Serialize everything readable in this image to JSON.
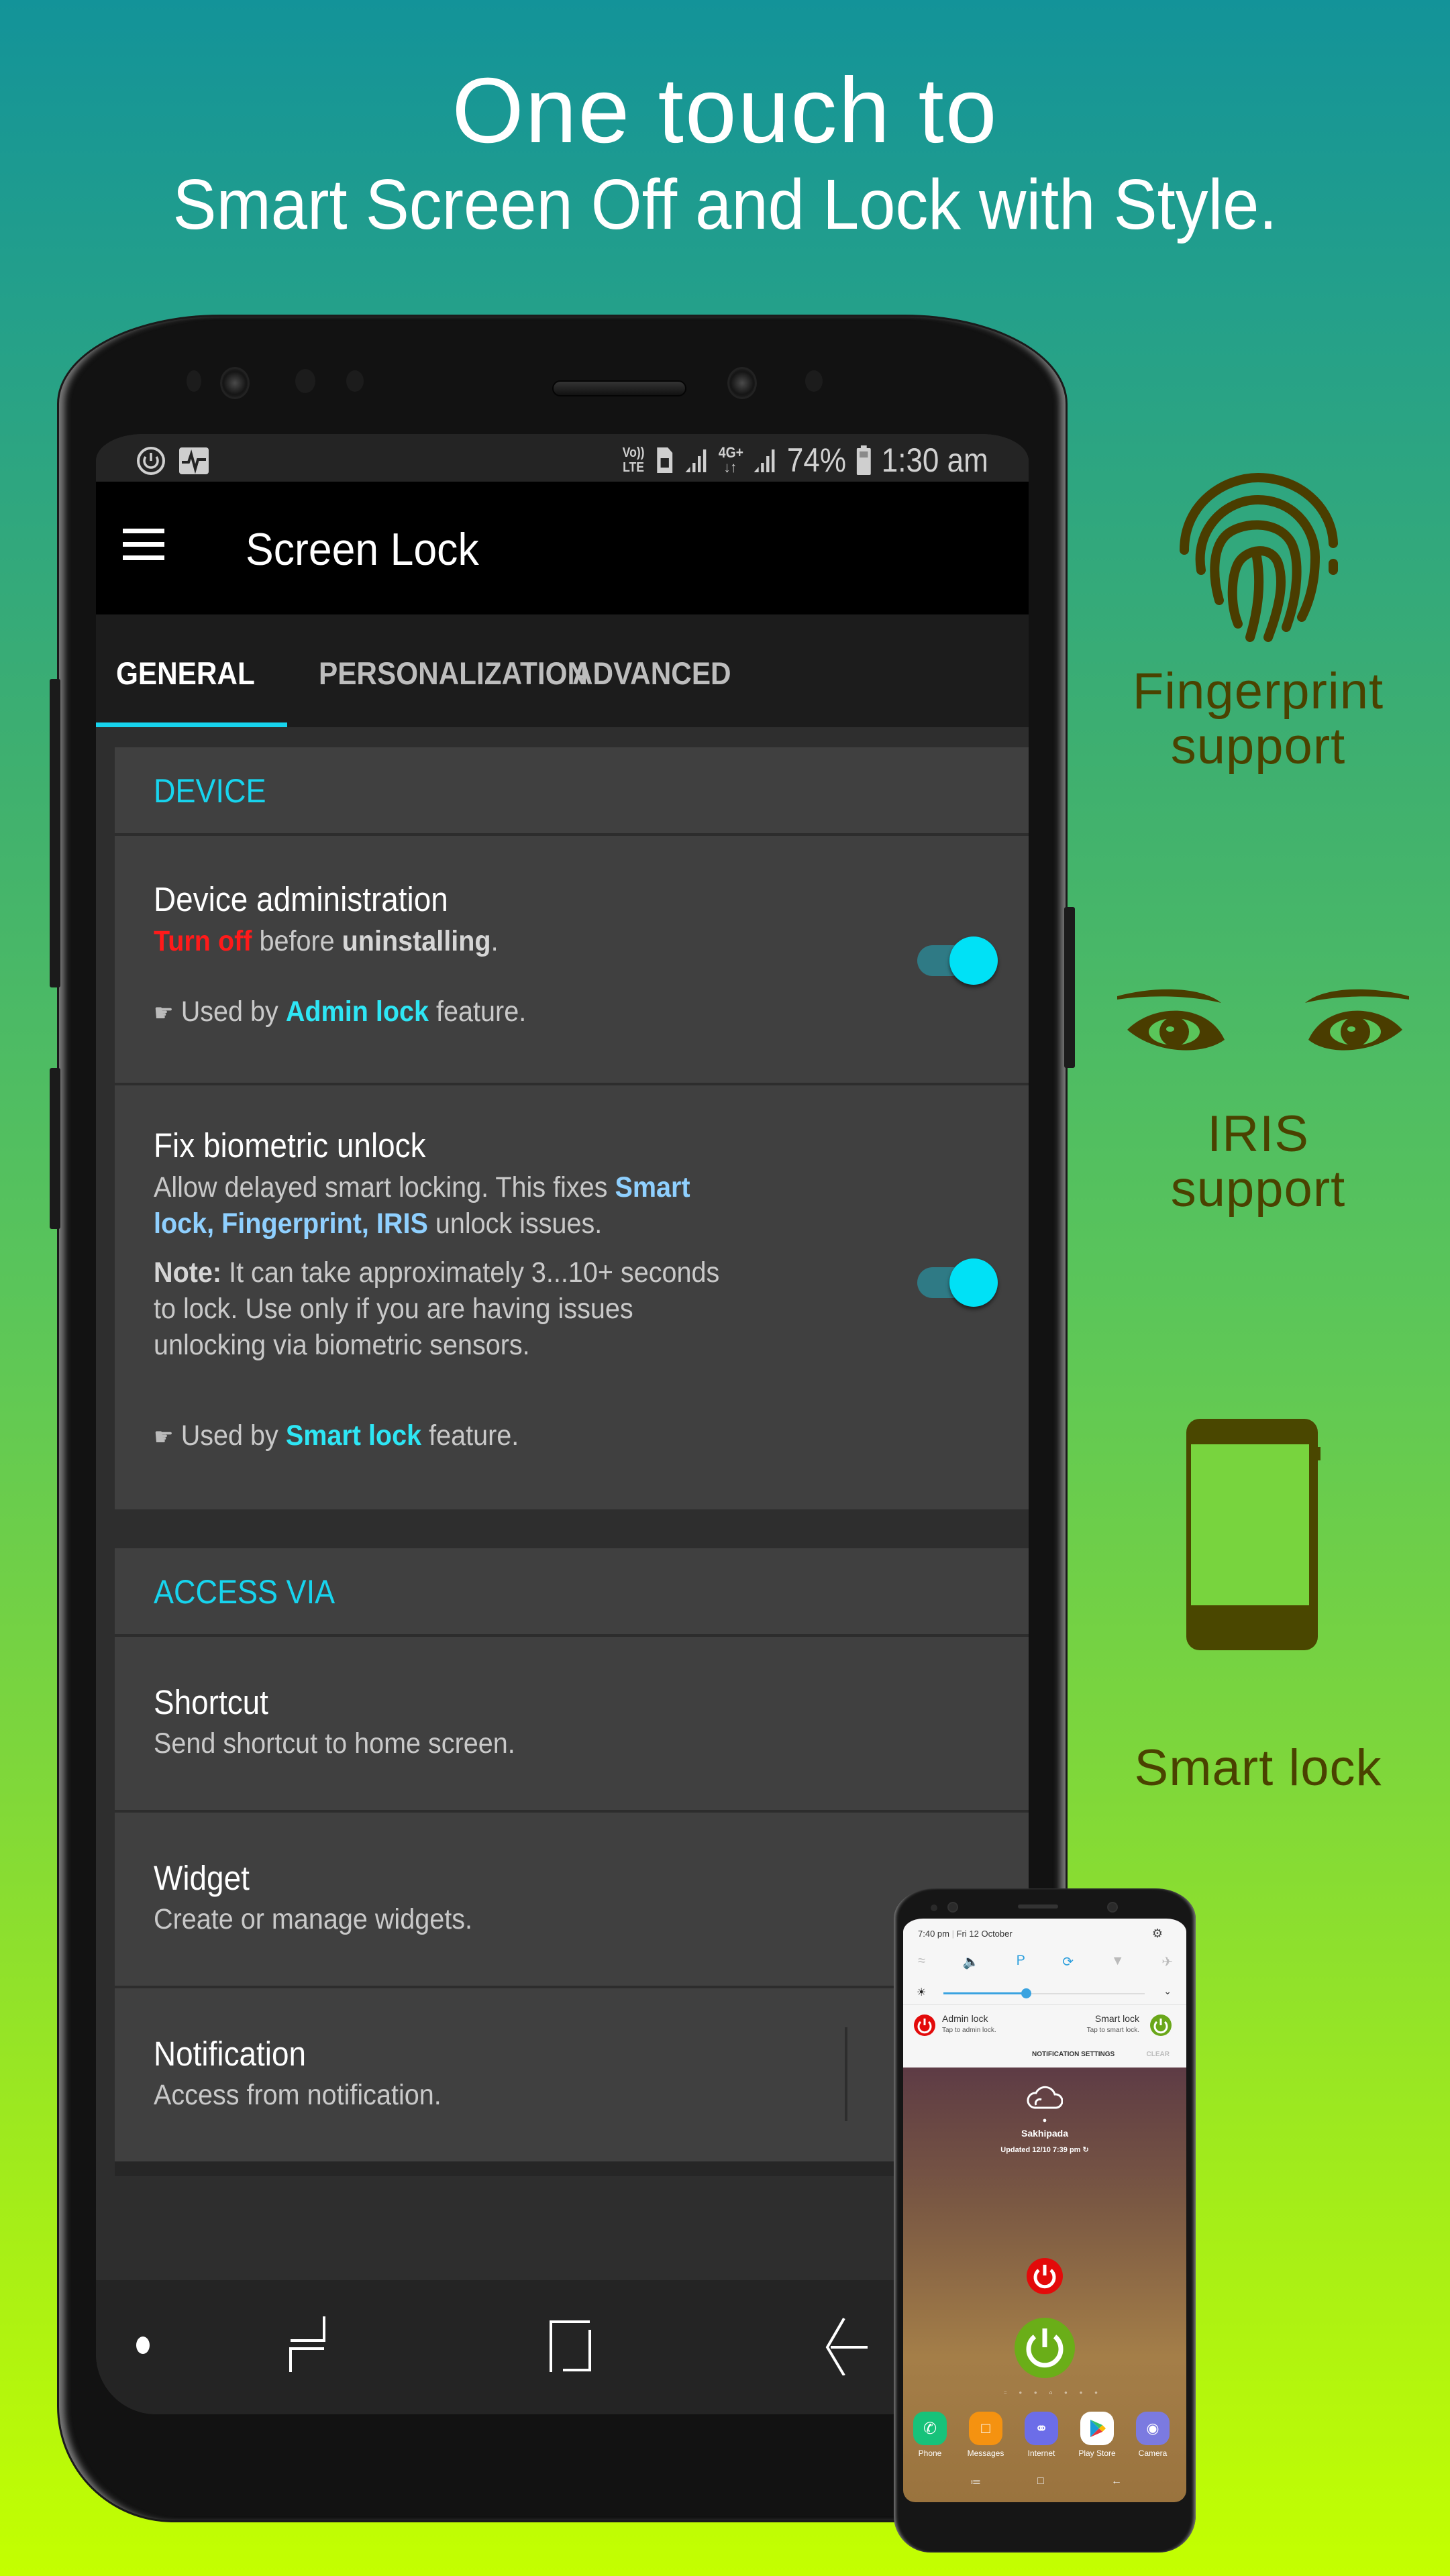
{
  "headline": {
    "line1": "One touch to",
    "line2": "Smart Screen Off and Lock with Style."
  },
  "status_bar": {
    "left_icons": [
      "power-icon",
      "activity-icon"
    ],
    "volte": "Vo)) LTE",
    "network_label": "4G+",
    "battery_percent": "74%",
    "time": "1:30 am"
  },
  "app_bar": {
    "title": "Screen Lock",
    "menu_icon": "hamburger-menu-icon"
  },
  "tabs": [
    {
      "label": "GENERAL",
      "active": true
    },
    {
      "label": "PERSONALIZATION",
      "active": false
    },
    {
      "label": "ADVANCED",
      "active": false
    }
  ],
  "colors": {
    "accent": "#17d4ee",
    "warning": "#ff1a1a",
    "link": "#2ee6f5",
    "highlight": "#8fd0ff",
    "card": "#404040",
    "feature_text": "#4a4200"
  },
  "sections": {
    "device": {
      "header": "DEVICE",
      "device_admin": {
        "title": "Device administration",
        "summary_turn_off": "Turn off",
        "summary_before": " before ",
        "summary_uninstalling": "uninstalling",
        "summary_end": ".",
        "used_by_prefix": "Used by ",
        "used_by_feature": "Admin lock",
        "used_by_suffix": " feature.",
        "toggle_on": true
      },
      "fix_biometric": {
        "title": "Fix biometric unlock",
        "desc_1": "Allow delayed smart locking. This fixes ",
        "desc_highlight_1": "Smart",
        "desc_highlight_2": "lock, Fingerprint, IRIS",
        "desc_2": " unlock issues.",
        "note_label": "Note:",
        "note_line1": " It can take approximately 3...10+ seconds",
        "note_line2": "to lock. Use only if you are having issues",
        "note_line3": "unlocking via biometric sensors.",
        "used_by_prefix": "Used by ",
        "used_by_feature": "Smart lock",
        "used_by_suffix": " feature.",
        "toggle_on": true
      }
    },
    "access_via": {
      "header": "ACCESS VIA",
      "items": [
        {
          "title": "Shortcut",
          "summary": "Send shortcut to home screen."
        },
        {
          "title": "Widget",
          "summary": "Create or manage widgets."
        },
        {
          "title": "Notification",
          "summary": "Access from notification."
        }
      ]
    }
  },
  "features": [
    {
      "label_line1": "Fingerprint",
      "label_line2": "support",
      "icon": "fingerprint-icon"
    },
    {
      "label_line1": "IRIS",
      "label_line2": "support",
      "icon": "eyes-icon"
    },
    {
      "label_line1": "Smart lock",
      "label_line2": "",
      "icon": "smartphone-icon"
    }
  ],
  "mini_phone": {
    "quick_settings": {
      "time": "7:40 pm",
      "date": "Fri 12 October",
      "brightness_level": 0.41
    },
    "notification": {
      "admin_title": "Admin lock",
      "admin_sub": "Tap to admin lock.",
      "smart_title": "Smart lock",
      "smart_sub": "Tap to smart lock.",
      "settings_button": "NOTIFICATION SETTINGS",
      "clear_button": "CLEAR"
    },
    "weather": {
      "location": "Sakhipada",
      "updated": "Updated 12/10 7:39 pm"
    },
    "dock_apps": [
      {
        "label": "Phone",
        "color": "#17c27a"
      },
      {
        "label": "Messages",
        "color": "#f59210"
      },
      {
        "label": "Internet",
        "color": "#6c6de8"
      },
      {
        "label": "Play Store",
        "color": "#ffffff"
      },
      {
        "label": "Camera",
        "color": "#7b7ae0"
      }
    ]
  }
}
